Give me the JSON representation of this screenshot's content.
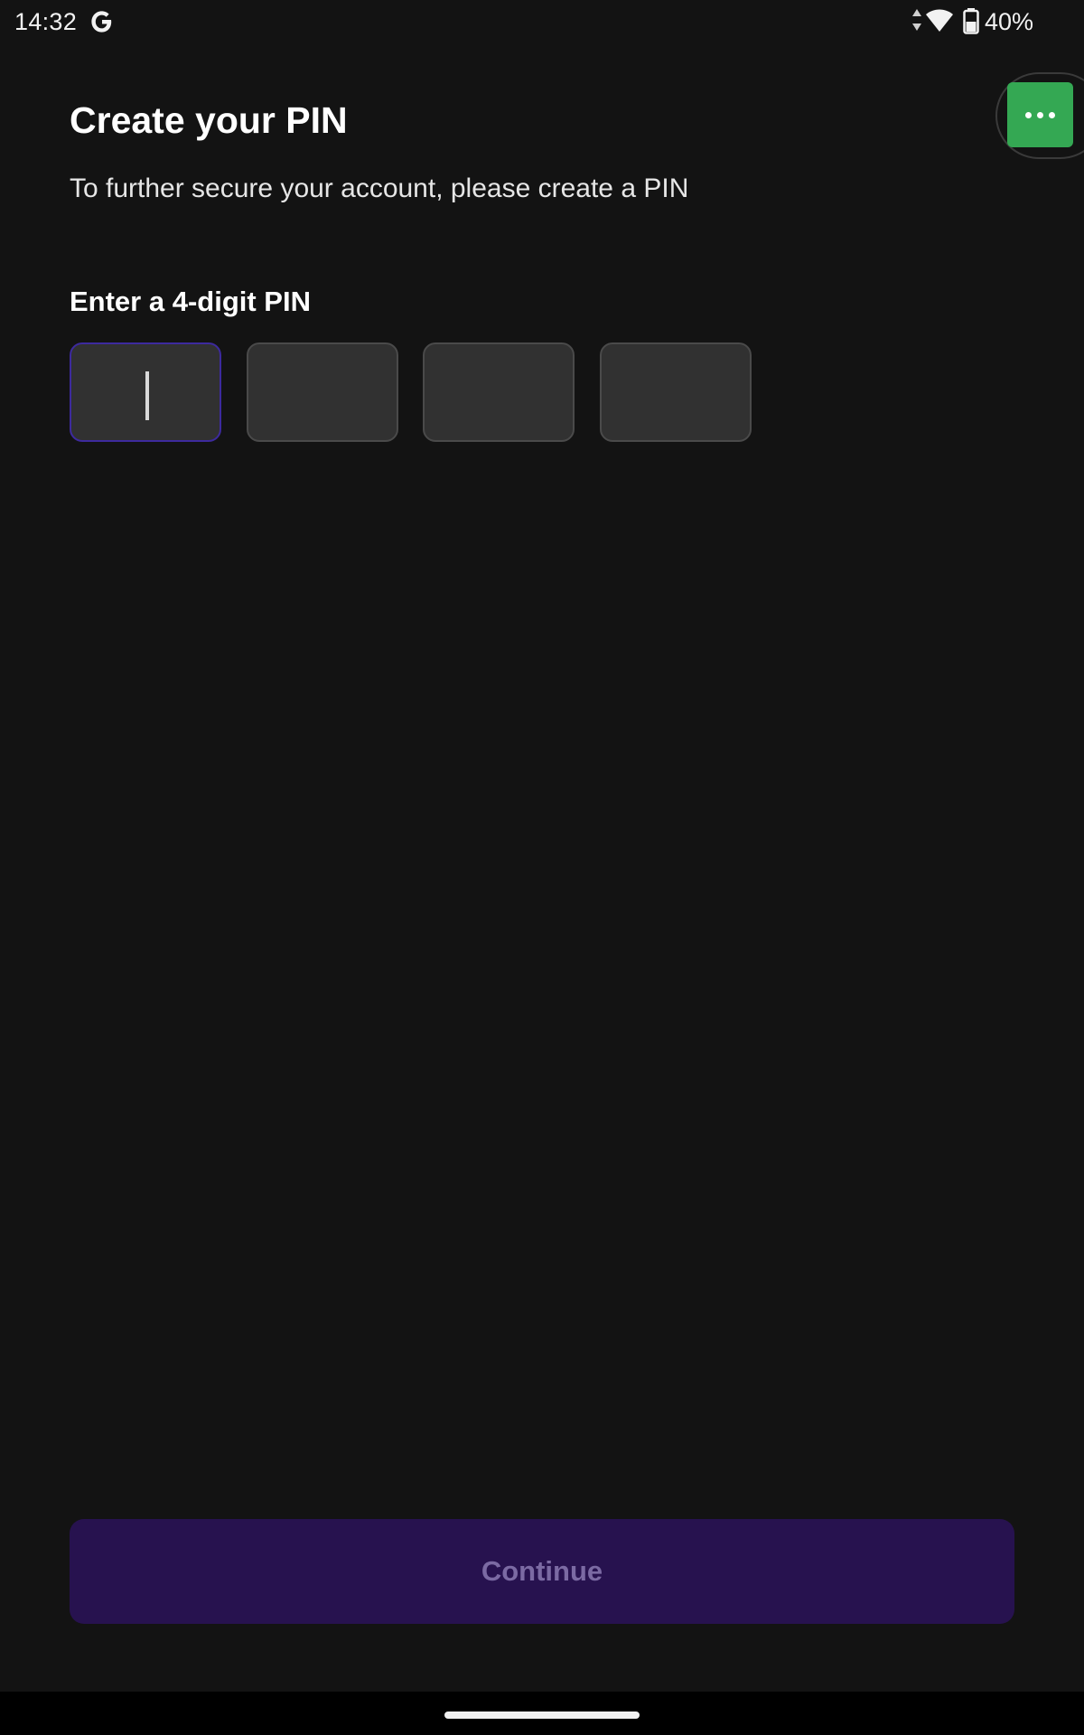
{
  "status_bar": {
    "time": "14:32",
    "battery_percent": "40%",
    "icons": [
      "google-g-icon",
      "data-arrows-icon",
      "wifi-icon",
      "battery-icon"
    ]
  },
  "floating_button": {
    "icon": "more-dots-icon",
    "color": "#34a853"
  },
  "page": {
    "title": "Create your PIN",
    "subtitle": "To further secure your account, please create a PIN",
    "pin_label": "Enter a 4-digit PIN",
    "pin_digits": [
      "",
      "",
      "",
      ""
    ],
    "focused_digit_index": 0
  },
  "continue_button": {
    "label": "Continue",
    "enabled": false,
    "background": "#27124f",
    "text_color": "#7b6aa3"
  },
  "colors": {
    "background": "#131313",
    "focus_border": "#3d2a9e",
    "pin_box": "#313131"
  }
}
